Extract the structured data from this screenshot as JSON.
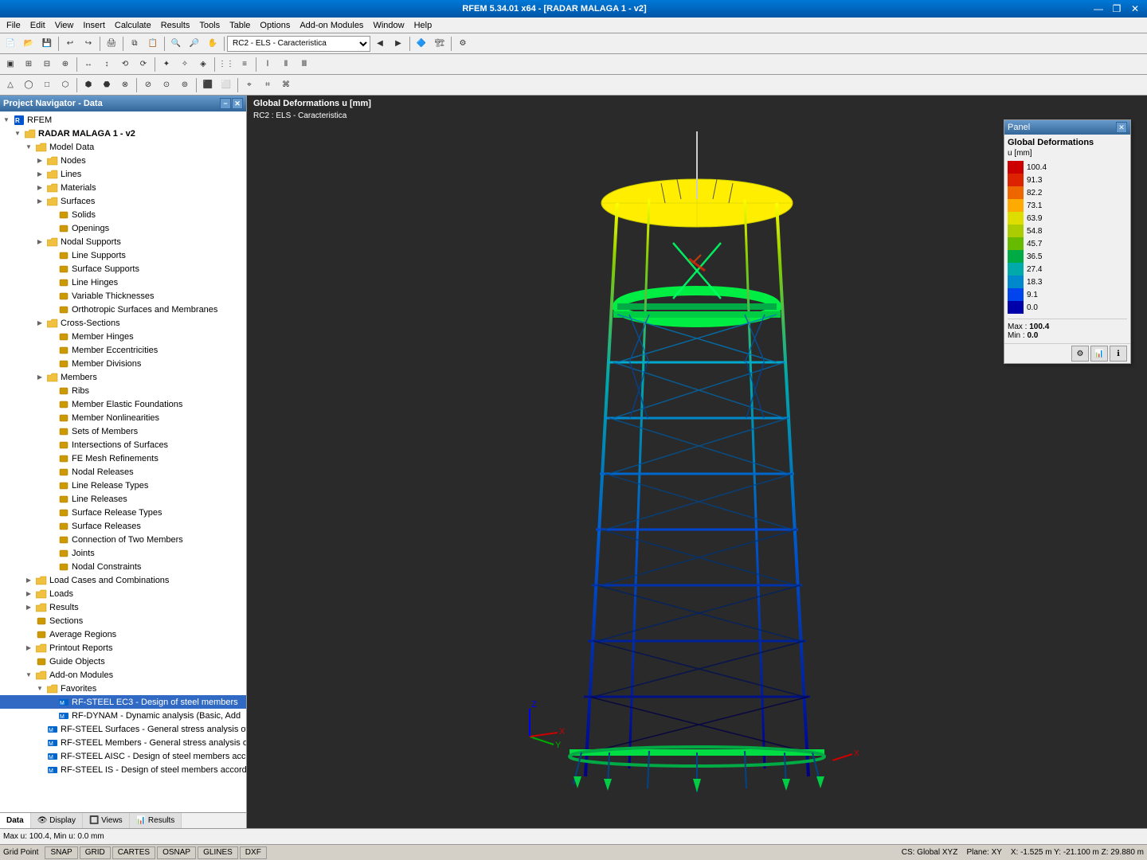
{
  "titleBar": {
    "title": "RFEM 5.34.01 x64 - [RADAR MALAGA 1 - v2]",
    "controls": [
      "—",
      "❐",
      "✕"
    ]
  },
  "menuBar": {
    "items": [
      "File",
      "Edit",
      "View",
      "Insert",
      "Calculate",
      "Results",
      "Tools",
      "Table",
      "Options",
      "Add-on Modules",
      "Window",
      "Help"
    ]
  },
  "toolbar1": {
    "dropdown": "RC2 - ELS - Caracteristica"
  },
  "viewport": {
    "label1": "Global Deformations u [mm]",
    "label2": "RC2 : ELS - Caracteristica"
  },
  "panel": {
    "title": "Panel",
    "close": "✕",
    "label": "Global Deformations",
    "unit": "u [mm]",
    "scaleValues": [
      {
        "color": "#cc0000",
        "label": "100.4"
      },
      {
        "color": "#dd2200",
        "label": "91.3"
      },
      {
        "color": "#ee6600",
        "label": "82.2"
      },
      {
        "color": "#ffaa00",
        "label": "73.1"
      },
      {
        "color": "#dddd00",
        "label": "63.9"
      },
      {
        "color": "#aacc00",
        "label": "54.8"
      },
      {
        "color": "#66bb00",
        "label": "45.7"
      },
      {
        "color": "#00aa44",
        "label": "36.5"
      },
      {
        "color": "#00aaaa",
        "label": "27.4"
      },
      {
        "color": "#0088cc",
        "label": "18.3"
      },
      {
        "color": "#0044ee",
        "label": "9.1"
      },
      {
        "color": "#0000aa",
        "label": "0.0"
      }
    ],
    "max_label": "Max :",
    "max_value": "100.4",
    "min_label": "Min :",
    "min_value": "0.0"
  },
  "navigator": {
    "title": "Project Navigator - Data",
    "tree": [
      {
        "level": 0,
        "label": "RFEM",
        "type": "root",
        "expanded": true
      },
      {
        "level": 1,
        "label": "RADAR MALAGA 1 - v2",
        "type": "folder",
        "expanded": true,
        "bold": true
      },
      {
        "level": 2,
        "label": "Model Data",
        "type": "folder",
        "expanded": true
      },
      {
        "level": 3,
        "label": "Nodes",
        "type": "folder",
        "expanded": false
      },
      {
        "level": 3,
        "label": "Lines",
        "type": "folder",
        "expanded": false
      },
      {
        "level": 3,
        "label": "Materials",
        "type": "folder",
        "expanded": false
      },
      {
        "level": 3,
        "label": "Surfaces",
        "type": "folder",
        "expanded": false
      },
      {
        "level": 4,
        "label": "Solids",
        "type": "item"
      },
      {
        "level": 4,
        "label": "Openings",
        "type": "item"
      },
      {
        "level": 3,
        "label": "Nodal Supports",
        "type": "folder",
        "expanded": false
      },
      {
        "level": 4,
        "label": "Line Supports",
        "type": "item"
      },
      {
        "level": 4,
        "label": "Surface Supports",
        "type": "item"
      },
      {
        "level": 4,
        "label": "Line Hinges",
        "type": "item"
      },
      {
        "level": 4,
        "label": "Variable Thicknesses",
        "type": "item"
      },
      {
        "level": 4,
        "label": "Orthotropic Surfaces and Membranes",
        "type": "item"
      },
      {
        "level": 3,
        "label": "Cross-Sections",
        "type": "folder",
        "expanded": false
      },
      {
        "level": 4,
        "label": "Member Hinges",
        "type": "item"
      },
      {
        "level": 4,
        "label": "Member Eccentricities",
        "type": "item"
      },
      {
        "level": 4,
        "label": "Member Divisions",
        "type": "item"
      },
      {
        "level": 3,
        "label": "Members",
        "type": "folder",
        "expanded": false
      },
      {
        "level": 4,
        "label": "Ribs",
        "type": "item"
      },
      {
        "level": 4,
        "label": "Member Elastic Foundations",
        "type": "item"
      },
      {
        "level": 4,
        "label": "Member Nonlinearities",
        "type": "item"
      },
      {
        "level": 4,
        "label": "Sets of Members",
        "type": "item"
      },
      {
        "level": 4,
        "label": "Intersections of Surfaces",
        "type": "item"
      },
      {
        "level": 4,
        "label": "FE Mesh Refinements",
        "type": "item"
      },
      {
        "level": 4,
        "label": "Nodal Releases",
        "type": "item"
      },
      {
        "level": 4,
        "label": "Line Release Types",
        "type": "item"
      },
      {
        "level": 4,
        "label": "Line Releases",
        "type": "item"
      },
      {
        "level": 4,
        "label": "Surface Release Types",
        "type": "item"
      },
      {
        "level": 4,
        "label": "Surface Releases",
        "type": "item"
      },
      {
        "level": 4,
        "label": "Connection of Two Members",
        "type": "item"
      },
      {
        "level": 4,
        "label": "Joints",
        "type": "item"
      },
      {
        "level": 4,
        "label": "Nodal Constraints",
        "type": "item"
      },
      {
        "level": 2,
        "label": "Load Cases and Combinations",
        "type": "folder",
        "expanded": false
      },
      {
        "level": 2,
        "label": "Loads",
        "type": "folder",
        "expanded": false
      },
      {
        "level": 2,
        "label": "Results",
        "type": "folder",
        "expanded": false
      },
      {
        "level": 2,
        "label": "Sections",
        "type": "item"
      },
      {
        "level": 2,
        "label": "Average Regions",
        "type": "item"
      },
      {
        "level": 2,
        "label": "Printout Reports",
        "type": "folder",
        "expanded": false
      },
      {
        "level": 2,
        "label": "Guide Objects",
        "type": "item"
      },
      {
        "level": 2,
        "label": "Add-on Modules",
        "type": "folder",
        "expanded": true
      },
      {
        "level": 3,
        "label": "Favorites",
        "type": "folder",
        "expanded": true
      },
      {
        "level": 4,
        "label": "RF-STEEL EC3 - Design of steel members",
        "type": "module",
        "selected": true
      },
      {
        "level": 4,
        "label": "RF-DYNAM - Dynamic analysis (Basic, Add",
        "type": "module"
      },
      {
        "level": 4,
        "label": "RF-STEEL Surfaces - General stress analysis of s",
        "type": "module"
      },
      {
        "level": 4,
        "label": "RF-STEEL Members - General stress analysis of",
        "type": "module"
      },
      {
        "level": 4,
        "label": "RF-STEEL AISC - Design of steel members acco",
        "type": "module"
      },
      {
        "level": 4,
        "label": "RF-STEEL IS - Design of steel members accordi",
        "type": "module"
      }
    ],
    "tabs": [
      "Data",
      "Display",
      "Views",
      "Results"
    ]
  },
  "bottomBar": {
    "text": "Max u: 100.4, Min u: 0.0 mm"
  },
  "statusBar": {
    "left": "Grid Point",
    "buttons": [
      "SNAP",
      "GRID",
      "CARTES",
      "OSNAP",
      "GLINES",
      "DXF"
    ],
    "cs": "CS: Global XYZ",
    "plane": "Plane: XY",
    "coords": "X: -1.525 m   Y: -21.100 m   Z: 29.880 m"
  }
}
